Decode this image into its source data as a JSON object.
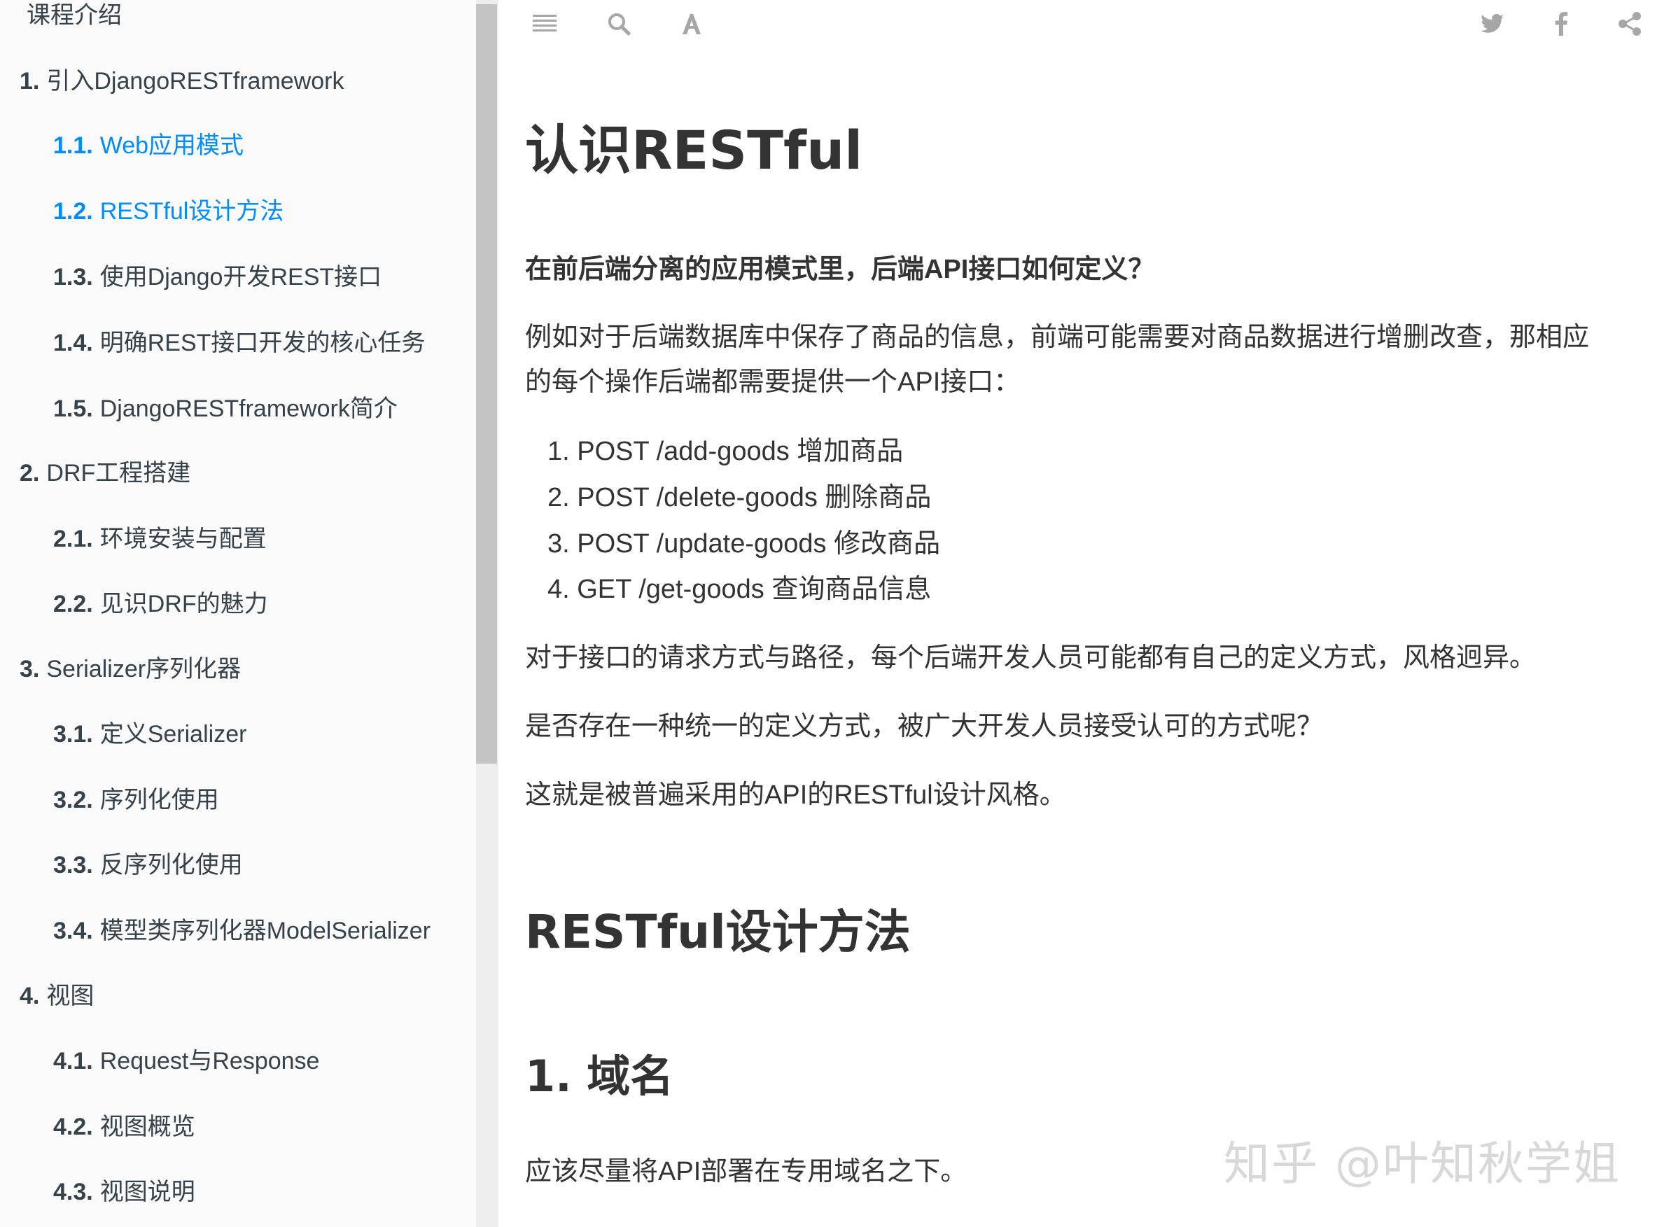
{
  "sidebar": {
    "items": [
      {
        "num": "",
        "label": "课程介绍",
        "level": 1,
        "active": false
      },
      {
        "num": "1.",
        "label": "引入DjangoRESTframework",
        "level": 1,
        "active": false
      },
      {
        "num": "1.1.",
        "label": "Web应用模式",
        "level": 2,
        "active": true
      },
      {
        "num": "1.2.",
        "label": "RESTful设计方法",
        "level": 2,
        "active": true
      },
      {
        "num": "1.3.",
        "label": "使用Django开发REST接口",
        "level": 2,
        "active": false
      },
      {
        "num": "1.4.",
        "label": "明确REST接口开发的核心任务",
        "level": 2,
        "active": false
      },
      {
        "num": "1.5.",
        "label": "DjangoRESTframework简介",
        "level": 2,
        "active": false
      },
      {
        "num": "2.",
        "label": "DRF工程搭建",
        "level": 1,
        "active": false
      },
      {
        "num": "2.1.",
        "label": "环境安装与配置",
        "level": 2,
        "active": false
      },
      {
        "num": "2.2.",
        "label": "见识DRF的魅力",
        "level": 2,
        "active": false
      },
      {
        "num": "3.",
        "label": "Serializer序列化器",
        "level": 1,
        "active": false
      },
      {
        "num": "3.1.",
        "label": "定义Serializer",
        "level": 2,
        "active": false
      },
      {
        "num": "3.2.",
        "label": "序列化使用",
        "level": 2,
        "active": false
      },
      {
        "num": "3.3.",
        "label": "反序列化使用",
        "level": 2,
        "active": false
      },
      {
        "num": "3.4.",
        "label": "模型类序列化器ModelSerializer",
        "level": 2,
        "active": false
      },
      {
        "num": "4.",
        "label": "视图",
        "level": 1,
        "active": false
      },
      {
        "num": "4.1.",
        "label": "Request与Response",
        "level": 2,
        "active": false
      },
      {
        "num": "4.2.",
        "label": "视图概览",
        "level": 2,
        "active": false
      },
      {
        "num": "4.3.",
        "label": "视图说明",
        "level": 2,
        "active": false
      }
    ]
  },
  "toolbar": {
    "left_icons": [
      "menu-icon",
      "search-icon",
      "font-settings-icon"
    ],
    "right_icons": [
      "twitter-icon",
      "facebook-icon",
      "share-icon"
    ],
    "icon_color": "#a6a6a6"
  },
  "content": {
    "title": "认识RESTful",
    "lead_question": "在前后端分离的应用模式里，后端API接口如何定义？",
    "intro_line1": "例如对于后端数据库中保存了商品的信息，前端可能需要对商品数据进行增删改查，那相应",
    "intro_line2": "的每个操作后端都需要提供一个API接口：",
    "api_list": [
      "1. POST /add-goods 增加商品",
      "2. POST /delete-goods 删除商品",
      "3. POST /update-goods 修改商品",
      "4. GET /get-goods 查询商品信息"
    ],
    "para_style": "对于接口的请求方式与路径，每个后端开发人员可能都有自己的定义方式，风格迥异。",
    "para_question": "是否存在一种统一的定义方式，被广大开发人员接受认可的方式呢？",
    "para_answer": "这就是被普遍采用的API的RESTful设计风格。",
    "section_title": "RESTful设计方法",
    "sub_title": "1. 域名",
    "domain_para": "应该尽量将API部署在专用域名之下。"
  },
  "watermark": "知乎 @叶知秋学姐",
  "colors": {
    "active_link": "#008cff",
    "sidebar_bg": "#fafafa",
    "text": "#333333"
  }
}
